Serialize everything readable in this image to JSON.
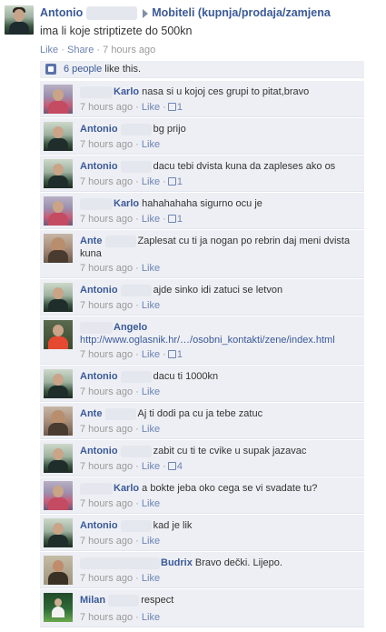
{
  "post": {
    "author": "Antonio",
    "group": "Mobiteli (kupnja/prodaja/zamjena",
    "status": "ima li koje striptizete do 500kn",
    "like_label": "Like",
    "share_label": "Share",
    "sep": "·",
    "time": "7 hours ago"
  },
  "likes": {
    "count_label": "6 people",
    "suffix": " like this."
  },
  "comments": [
    {
      "name": "Karlo",
      "lead": true,
      "text": " nasa si u kojoj ces grupi to pitat,bravo",
      "time": "7 hours ago",
      "likes": "1",
      "avatar": "av-karlo"
    },
    {
      "name": "Antonio",
      "lead": false,
      "text": "bg prijo",
      "time": "7 hours ago",
      "likes": null,
      "avatar": "av-antonio"
    },
    {
      "name": "Antonio",
      "lead": false,
      "text": "dacu tebi dvista kuna da zapleses ako os",
      "time": "7 hours ago",
      "likes": "1",
      "avatar": "av-antonio"
    },
    {
      "name": "Karlo",
      "lead": true,
      "text": " hahahahaha sigurno ocu je",
      "time": "7 hours ago",
      "likes": "1",
      "avatar": "av-karlo"
    },
    {
      "name": "Ante",
      "lead": false,
      "text": "Zaplesat cu ti ja nogan po rebrin daj meni dvista kuna",
      "time": "7 hours ago",
      "likes": null,
      "avatar": "av-ante"
    },
    {
      "name": "Antonio",
      "lead": false,
      "text": "ajde sinko idi zatuci se letvon",
      "time": "7 hours ago",
      "likes": null,
      "avatar": "av-antonio"
    },
    {
      "name": "Angelo",
      "lead": true,
      "text": "http://www.oglasnik.hr/…/osobni_kontakti/zene/index.html",
      "time": "7 hours ago",
      "likes": "1",
      "avatar": "av-angelo",
      "is_link": true
    },
    {
      "name": "Antonio",
      "lead": false,
      "text": "dacu ti 1000kn",
      "time": "7 hours ago",
      "likes": null,
      "avatar": "av-antonio"
    },
    {
      "name": "Ante",
      "lead": false,
      "text": "Aj ti dodi pa cu ja tebe zatuc",
      "time": "7 hours ago",
      "likes": null,
      "avatar": "av-ante"
    },
    {
      "name": "Antonio",
      "lead": false,
      "text": "zabit cu ti te cvike u supak jazavac",
      "time": "7 hours ago",
      "likes": "4",
      "avatar": "av-antonio"
    },
    {
      "name": "Karlo",
      "lead": true,
      "text": " a bokte jeba oko cega se vi svadate tu?",
      "time": "7 hours ago",
      "likes": null,
      "avatar": "av-karlo"
    },
    {
      "name": "Antonio",
      "lead": false,
      "text": "kad je lik",
      "time": "7 hours ago",
      "likes": null,
      "avatar": "av-antonio"
    },
    {
      "name": "Budrix",
      "lead": true,
      "long": true,
      "text": " Bravo dečki. Lijepo.",
      "time": "7 hours ago",
      "likes": null,
      "avatar": "av-budrix"
    },
    {
      "name": "Milan",
      "lead": false,
      "text": "respect",
      "time": "7 hours ago",
      "likes": null,
      "avatar": "av-milan"
    }
  ],
  "comment_like_label": "Like",
  "icons": {
    "like": "thumbs-up-icon",
    "arrow": "arrow-right-icon"
  },
  "colors": {
    "link": "#3b5998",
    "meta": "#999999",
    "comment_bg": "#edeff4"
  }
}
